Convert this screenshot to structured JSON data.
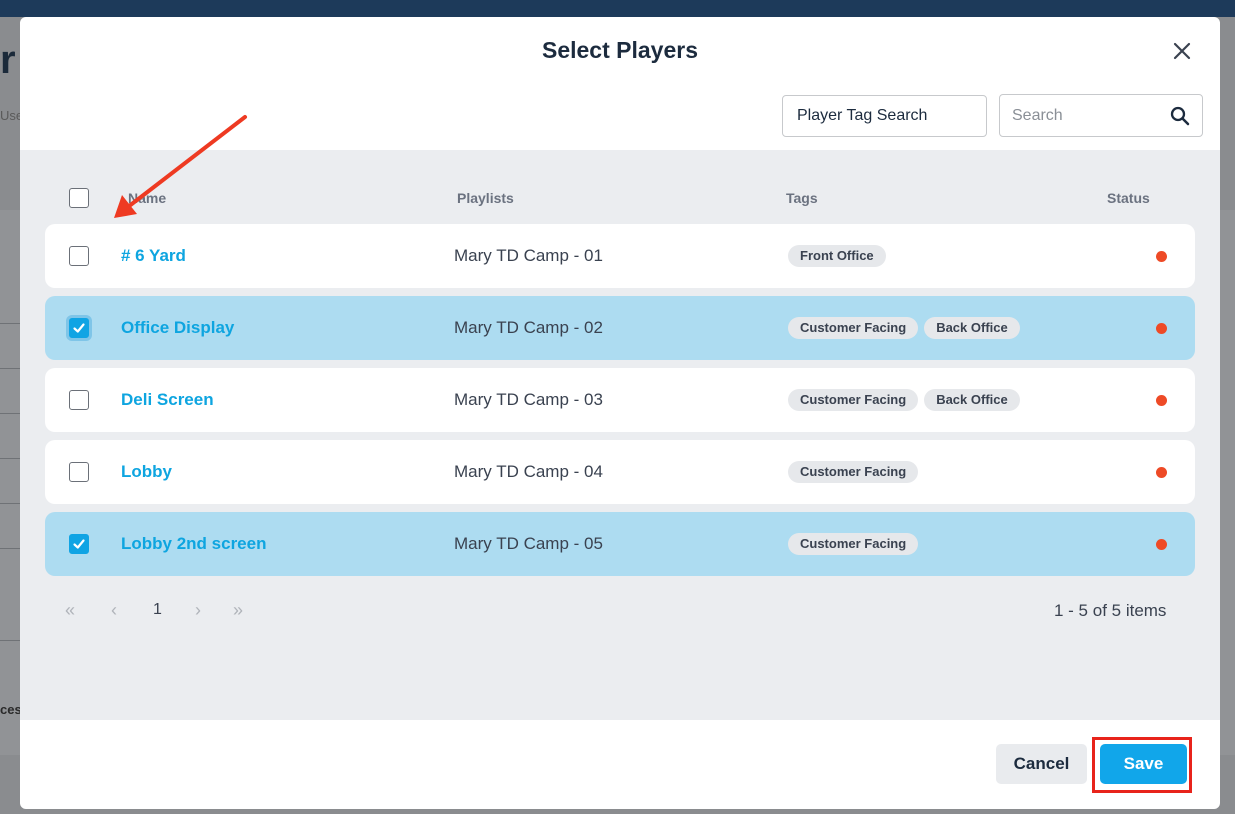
{
  "background": {
    "letter": "r",
    "sub_label": "Use",
    "sub_label_2": "ces"
  },
  "modal": {
    "title": "Select Players",
    "close_icon": "close-icon",
    "tag_search_placeholder": "Player Tag Search",
    "search_placeholder": "Search",
    "search_icon": "search-icon"
  },
  "table": {
    "columns": [
      "Name",
      "Playlists",
      "Tags",
      "Status"
    ],
    "rows": [
      {
        "name": "# 6 Yard",
        "playlist": "Mary TD Camp - 01",
        "tags": [
          "Front Office"
        ],
        "checked": false
      },
      {
        "name": "Office Display",
        "playlist": "Mary TD Camp - 02",
        "tags": [
          "Customer Facing",
          "Back Office"
        ],
        "checked": true
      },
      {
        "name": "Deli Screen",
        "playlist": "Mary TD Camp - 03",
        "tags": [
          "Customer Facing",
          "Back Office"
        ],
        "checked": false
      },
      {
        "name": "Lobby",
        "playlist": "Mary TD Camp - 04",
        "tags": [
          "Customer Facing"
        ],
        "checked": false
      },
      {
        "name": "Lobby 2nd screen",
        "playlist": "Mary TD Camp - 05",
        "tags": [
          "Customer Facing"
        ],
        "checked": true
      }
    ],
    "status_color": "#ee4a26"
  },
  "pagination": {
    "first": "«",
    "prev": "‹",
    "page": "1",
    "next": "›",
    "last": "»",
    "info": "1 - 5 of 5 items"
  },
  "footer": {
    "cancel_label": "Cancel",
    "save_label": "Save"
  },
  "colors": {
    "accent": "#10a4e4",
    "selected_row": "#addcf1",
    "annotation": "#e8231b"
  }
}
